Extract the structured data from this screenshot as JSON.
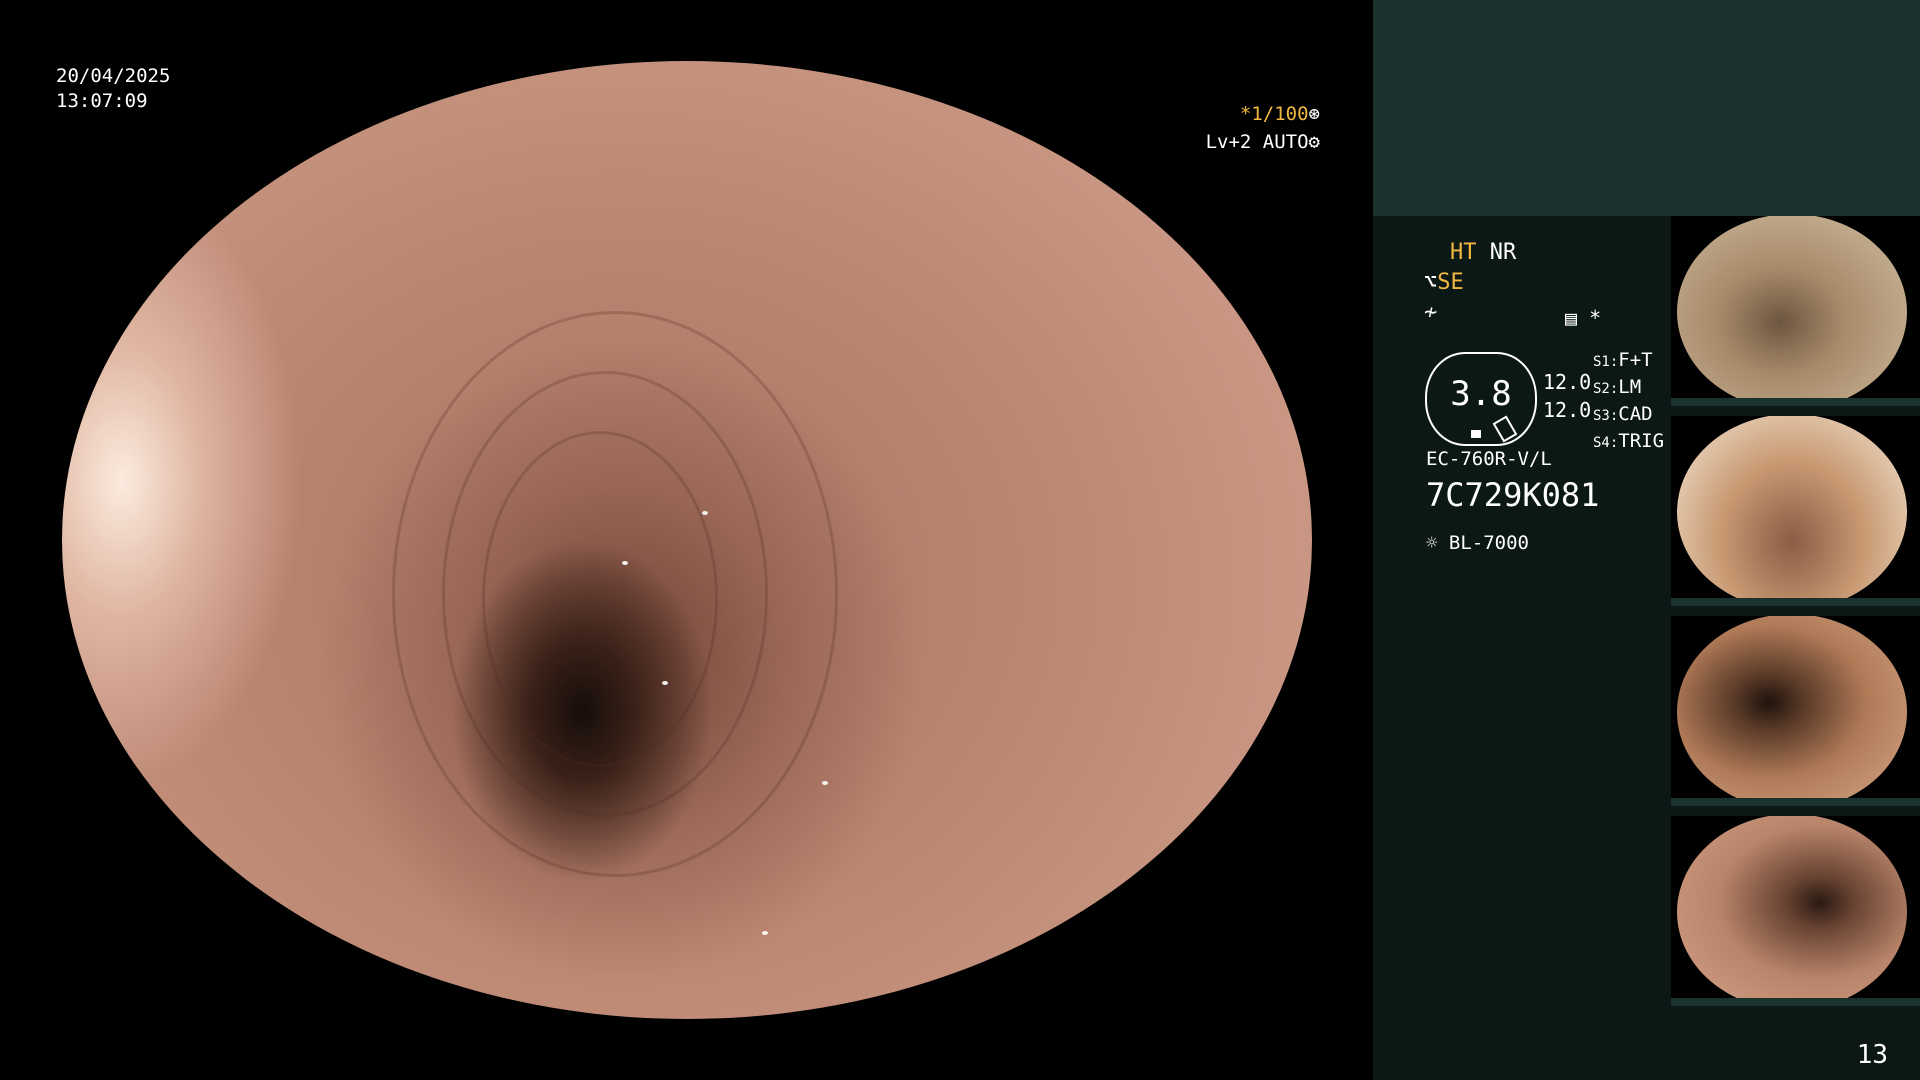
{
  "overlay": {
    "date": "20/04/2025",
    "time": "13:07:09",
    "shutter": "*1/100",
    "shutter_icon": "aperture-icon",
    "level": "Lv+2",
    "mode": "AUTO",
    "mode_icon": "settings-icon"
  },
  "panel": {
    "ht": "HT",
    "nr": "NR",
    "se": "SE",
    "se_icon": "scope-bend-icon",
    "f_icon": "freeze-icon",
    "menu_icon": "document-icon",
    "star": "*",
    "gauge_value": "3.8",
    "val1": "12.0",
    "val2": "12.0",
    "s1_key": "S1:",
    "s1_val": "F+T",
    "s2_key": "S2:",
    "s2_val": "LM",
    "s3_key": "S3:",
    "s3_val": "CAD",
    "s4_key": "S4:",
    "s4_val": "TRIG",
    "scope_model": "EC-760R-V/L",
    "serial": "7C729K081",
    "light_icon": "light-source-icon",
    "light_source": "BL-7000"
  },
  "thumbnails": [
    {
      "name": "thumb-1",
      "bg": "#a78a6a"
    },
    {
      "name": "thumb-2",
      "bg": "#c99a73"
    },
    {
      "name": "thumb-3",
      "bg": "#b07a57"
    },
    {
      "name": "thumb-4",
      "bg": "#b8846a"
    }
  ],
  "page_number": "13",
  "colors": {
    "panel_bg": "#0c1816",
    "panel_header": "#1b322f",
    "accent_yellow": "#f0b840"
  }
}
